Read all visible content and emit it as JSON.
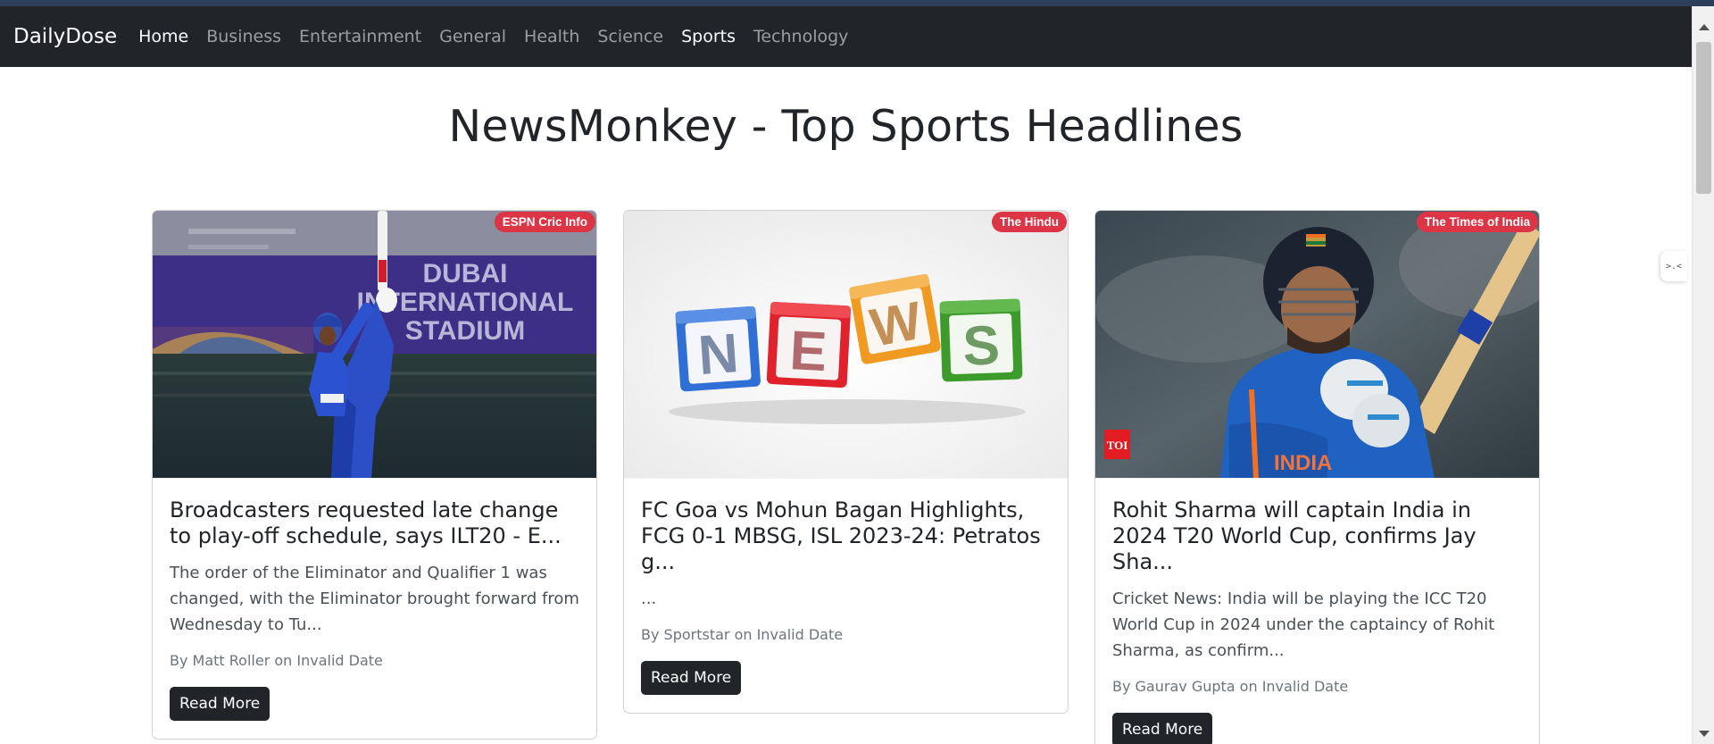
{
  "navbar": {
    "brand": "DailyDose",
    "links": [
      {
        "label": "Home",
        "active": true
      },
      {
        "label": "Business",
        "active": false
      },
      {
        "label": "Entertainment",
        "active": false
      },
      {
        "label": "General",
        "active": false
      },
      {
        "label": "Health",
        "active": false
      },
      {
        "label": "Science",
        "active": false
      },
      {
        "label": "Sports",
        "active": true
      },
      {
        "label": "Technology",
        "active": false
      }
    ]
  },
  "page": {
    "title": "NewsMonkey - Top Sports Headlines"
  },
  "cards": [
    {
      "source": "ESPN Cric Info",
      "image": "cricket-batsman-dubai-stadium",
      "image_text": [
        "DUBAI",
        "INTERNATIONAL",
        "STADIUM"
      ],
      "title": "Broadcasters requested late change to play-off schedule, says ILT20 - E...",
      "description": "The order of the Eliminator and Qualifier 1 was changed, with the Eliminator brought forward from Wednesday to Tu...",
      "meta": "By Matt Roller on Invalid Date",
      "button": "Read More"
    },
    {
      "source": "The Hindu",
      "image": "news-blocks",
      "image_text": [
        "N",
        "E",
        "W",
        "S"
      ],
      "title": "FC Goa vs Mohun Bagan Highlights, FCG 0-1 MBSG, ISL 2023-24: Petratos g...",
      "description": "...",
      "meta": "By Sportstar on Invalid Date",
      "button": "Read More"
    },
    {
      "source": "The Times of India",
      "image": "cricket-player-india-jersey",
      "image_text": [
        "TOI",
        "INDIA"
      ],
      "title": "Rohit Sharma will captain India in 2024 T20 World Cup, confirms Jay Sha...",
      "description": "Cricket News: India will be playing the ICC T20 World Cup in 2024 under the captaincy of Rohit Sharma, as confirm...",
      "meta": "By Gaurav Gupta on Invalid Date",
      "button": "Read More"
    }
  ],
  "extension_tab": {
    "glyph": ">.<"
  },
  "colors": {
    "navbar_bg": "#212529",
    "badge": "#dc3545",
    "button": "#212529",
    "topline": "#2d3f5d"
  }
}
